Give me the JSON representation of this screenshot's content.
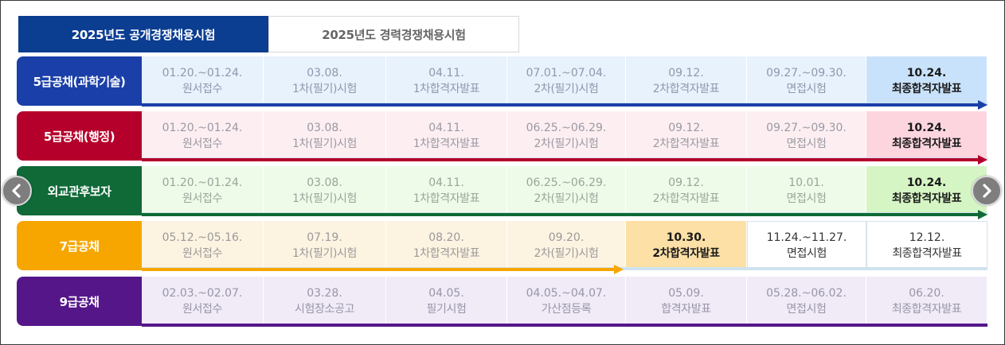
{
  "tabs": [
    {
      "label": "2025년도 공개경쟁채용시험",
      "active": true
    },
    {
      "label": "2025년도 경력경쟁채용시험",
      "active": false
    }
  ],
  "icons": {
    "prev": "chevron-left-icon",
    "next": "chevron-right-icon"
  },
  "rows": [
    {
      "label": "5급공채(과학기술)",
      "color": "#1b3fa8",
      "cell_bg": "#e8f2fd",
      "date_color": "#8d98ab",
      "highlight_bg": "#c9e2fb",
      "progress_color": "#1b3fa8",
      "progress_fraction": 1.0,
      "current_step": 7,
      "steps": [
        {
          "date": "01.20.~01.24.",
          "name": "원서접수"
        },
        {
          "date": "03.08.",
          "name": "1차(필기)시험"
        },
        {
          "date": "04.11.",
          "name": "1차합격자발표"
        },
        {
          "date": "07.01.~07.04.",
          "name": "2차(필기)시험"
        },
        {
          "date": "09.12.",
          "name": "2차합격자발표"
        },
        {
          "date": "09.27.~09.30.",
          "name": "면접시험"
        },
        {
          "date": "10.24.",
          "name": "최종합격자발표"
        }
      ]
    },
    {
      "label": "5급공채(행정)",
      "color": "#b5002c",
      "cell_bg": "#fdeef1",
      "date_color": "#9a9aa3",
      "highlight_bg": "#fdd5df",
      "progress_color": "#b5002c",
      "progress_fraction": 1.0,
      "current_step": 7,
      "steps": [
        {
          "date": "01.20.~01.24.",
          "name": "원서접수"
        },
        {
          "date": "03.08.",
          "name": "1차(필기)시험"
        },
        {
          "date": "04.11.",
          "name": "1차합격자발표"
        },
        {
          "date": "06.25.~06.29.",
          "name": "2차(필기)시험"
        },
        {
          "date": "09.12.",
          "name": "2차합격자발표"
        },
        {
          "date": "09.27.~09.30.",
          "name": "면접시험"
        },
        {
          "date": "10.24.",
          "name": "최종합격자발표"
        }
      ]
    },
    {
      "label": "외교관후보자",
      "color": "#0f6a37",
      "cell_bg": "#eefbe9",
      "date_color": "#9aa59a",
      "highlight_bg": "#d5f5c4",
      "progress_color": "#0f6a37",
      "progress_fraction": 1.0,
      "current_step": 7,
      "steps": [
        {
          "date": "01.20.~01.24.",
          "name": "원서접수"
        },
        {
          "date": "03.08.",
          "name": "1차(필기)시험"
        },
        {
          "date": "04.11.",
          "name": "1차합격자발표"
        },
        {
          "date": "06.25.~06.29.",
          "name": "2차(필기)시험"
        },
        {
          "date": "09.12.",
          "name": "2차합격자발표"
        },
        {
          "date": "10.01.",
          "name": "면접시험"
        },
        {
          "date": "10.24.",
          "name": "최종합격자발표"
        }
      ]
    },
    {
      "label": "7급공채",
      "color": "#f7a600",
      "cell_bg": "#fdf3e1",
      "date_color": "#9a9a9a",
      "highlight_bg": "#fde0a6",
      "progress_color": "#f7a600",
      "progress_fraction": 0.57,
      "current_step": 5,
      "steps": [
        {
          "date": "05.12.~05.16.",
          "name": "원서접수"
        },
        {
          "date": "07.19.",
          "name": "1차(필기)시험"
        },
        {
          "date": "08.20.",
          "name": "1차합격자발표"
        },
        {
          "date": "09.20.",
          "name": "2차(필기)시험"
        },
        {
          "date": "10.30.",
          "name": "2차합격자발표"
        },
        {
          "date": "11.24.~11.27.",
          "name": "면접시험"
        },
        {
          "date": "12.12.",
          "name": "최종합격자발표"
        }
      ]
    },
    {
      "label": "9급공채",
      "color": "#55168a",
      "cell_bg": "#f0ebf7",
      "date_color": "#9a95a8",
      "highlight_bg": "#f0ebf7",
      "progress_color": "#55168a",
      "progress_fraction": 1.0,
      "current_step": 0,
      "steps": [
        {
          "date": "02.03.~02.07.",
          "name": "원서접수"
        },
        {
          "date": "03.28.",
          "name": "시험장소공고"
        },
        {
          "date": "04.05.",
          "name": "필기시험"
        },
        {
          "date": "04.05.~04.07.",
          "name": "가산점등록"
        },
        {
          "date": "05.09.",
          "name": "합격자발표"
        },
        {
          "date": "05.28.~06.02.",
          "name": "면접시험"
        },
        {
          "date": "06.20.",
          "name": "최종합격자발표"
        }
      ]
    }
  ]
}
